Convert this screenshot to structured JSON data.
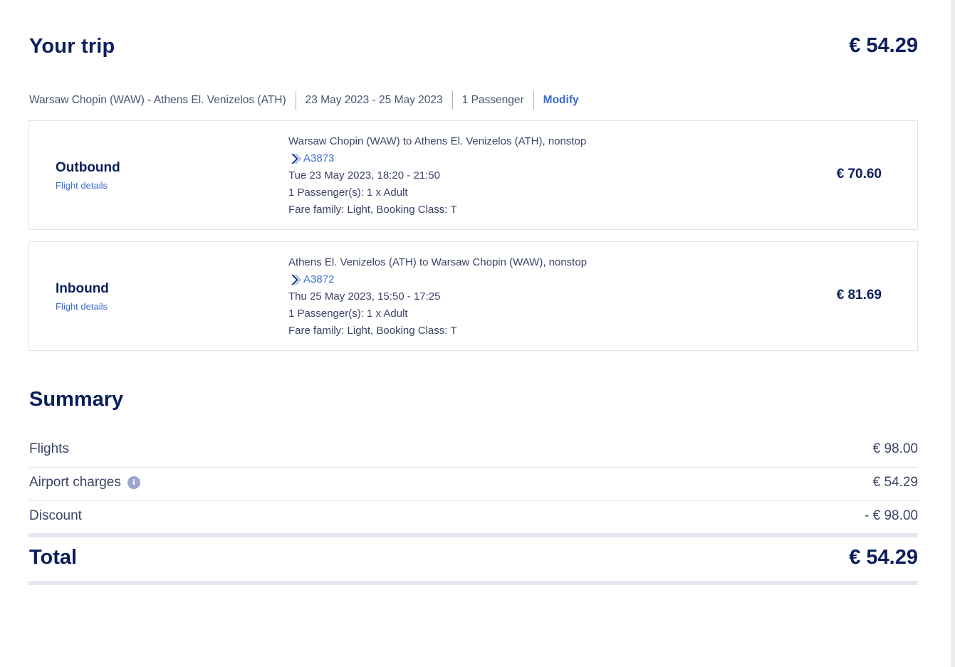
{
  "header": {
    "title": "Your trip",
    "total": "€ 54.29"
  },
  "info_bar": {
    "route": "Warsaw Chopin (WAW) - Athens El. Venizelos (ATH)",
    "dates": "23 May 2023 - 25 May 2023",
    "passengers": "1 Passenger",
    "modify_label": "Modify"
  },
  "flights": [
    {
      "direction": "Outbound",
      "details_link": "Flight details",
      "route": "Warsaw Chopin (WAW) to Athens El. Venizelos (ATH), nonstop",
      "flight_number": "A3873",
      "datetime": "Tue 23 May 2023, 18:20 - 21:50",
      "passengers": "1 Passenger(s): 1 x Adult",
      "fare": "Fare family: Light, Booking Class: T",
      "price": "€ 70.60"
    },
    {
      "direction": "Inbound",
      "details_link": "Flight details",
      "route": "Athens El. Venizelos (ATH) to Warsaw Chopin (WAW), nonstop",
      "flight_number": "A3872",
      "datetime": "Thu 25 May 2023, 15:50 - 17:25",
      "passengers": "1 Passenger(s): 1 x Adult",
      "fare": "Fare family: Light, Booking Class: T",
      "price": "€ 81.69"
    }
  ],
  "summary": {
    "title": "Summary",
    "rows": [
      {
        "label": "Flights",
        "value": "€ 98.00"
      },
      {
        "label": "Airport charges",
        "value": "€ 54.29",
        "icon": "info-icon"
      },
      {
        "label": "Discount",
        "value": "- € 98.00"
      }
    ],
    "total_label": "Total",
    "total_value": "€ 54.29"
  },
  "colors": {
    "primary_text": "#0a1f5c",
    "link": "#3a6ad6",
    "secondary_text": "#3a4466",
    "border": "#dfe2ea",
    "divider_thick": "#e4e7f2"
  }
}
